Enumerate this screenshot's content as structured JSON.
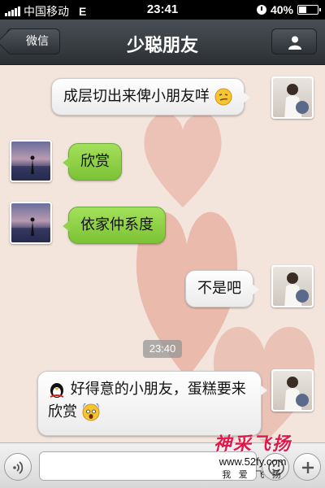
{
  "status_bar": {
    "carrier": "中国移动",
    "network": "E",
    "time": "23:41",
    "battery": "40%",
    "battery_level": 0.4
  },
  "header": {
    "back_label": "微信",
    "title": "少聪朋友",
    "profile_icon": "person-icon"
  },
  "messages": [
    {
      "direction": "outgoing",
      "text": "成层切出来俾小朋友咩",
      "emoji": "smirk-face-icon"
    },
    {
      "direction": "incoming",
      "text": "欣赏"
    },
    {
      "direction": "incoming",
      "text": "依家仲系度"
    },
    {
      "direction": "outgoing",
      "text": "不是吧"
    },
    {
      "direction": "outgoing",
      "text": "好得意的小朋友，蛋糕要来欣赏",
      "emoji_before": "penguin-icon",
      "emoji": "scream-face-icon"
    }
  ],
  "timestamp": "23:40",
  "input_bar": {
    "voice_icon": "voice-icon",
    "input_value": "",
    "emoji_icon": "smiley-icon",
    "plus_icon": "plus-icon"
  },
  "watermark": {
    "title": "神采飞扬",
    "url": "www.52fy.com",
    "slogan": "我 爱 飞 扬"
  },
  "colors": {
    "incoming_bubble": "#8fd147",
    "outgoing_bubble": "#ffffff",
    "chat_background": "#f3e5dc",
    "nav_bar": "#3b3f44",
    "watermark_red": "#e3184a"
  }
}
